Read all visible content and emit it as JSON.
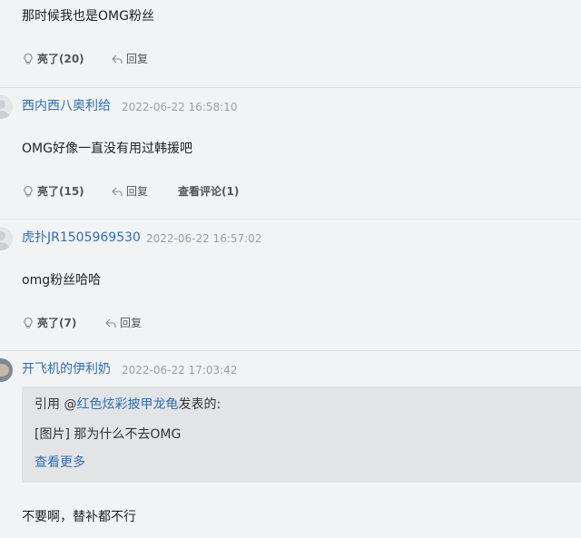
{
  "replies": [
    {
      "content": "那时候我也是OMG粉丝",
      "likes": "亮了(20)",
      "reply": "回复"
    },
    {
      "user": "西内西八奥利给",
      "time": "2022-06-22 16:58:10",
      "content": "OMG好像一直没有用过韩援吧",
      "likes": "亮了(15)",
      "reply": "回复",
      "view_comments": "查看评论(1)"
    },
    {
      "user": "虎扑JR1505969530",
      "time": "2022-06-22 16:57:02",
      "content": "omg粉丝哈哈",
      "likes": "亮了(7)",
      "reply": "回复"
    },
    {
      "user": "开飞机的伊利奶",
      "time": "2022-06-22 17:03:42",
      "quote": {
        "prefix": "引用 @",
        "quoted_user": "红色炫彩披甲龙龟",
        "suffix": "发表的:",
        "text": "[图片] 那为什么不去OMG",
        "more": "查看更多"
      },
      "content": "不要啊，替补都不行"
    }
  ]
}
